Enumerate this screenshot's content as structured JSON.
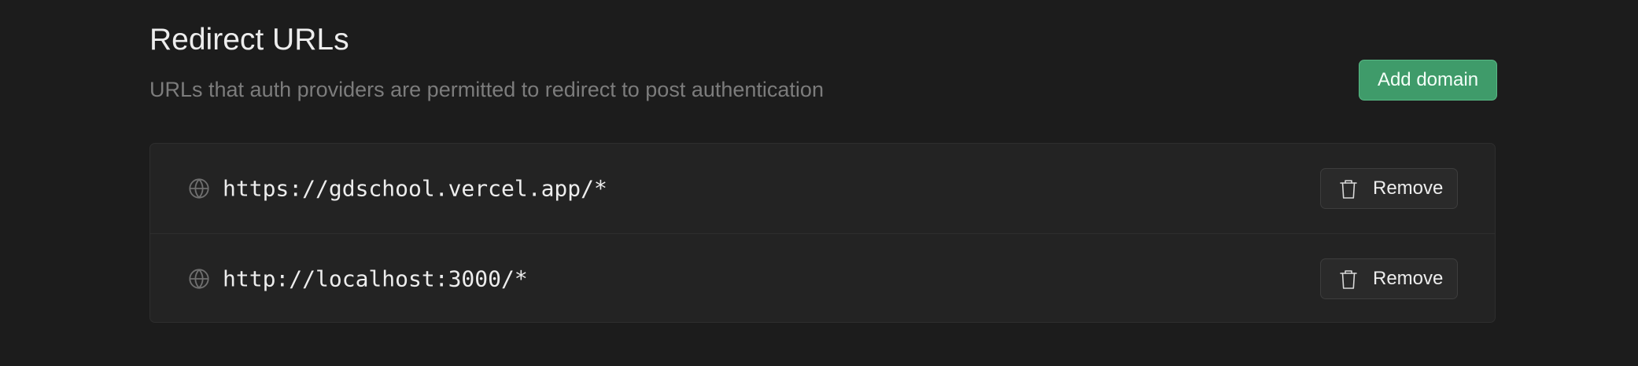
{
  "section": {
    "title": "Redirect URLs",
    "description": "URLs that auth providers are permitted to redirect to post authentication",
    "add_button_label": "Add domain"
  },
  "redirect_urls": [
    {
      "url": "https://gdschool.vercel.app/*",
      "remove_label": "Remove",
      "icon": "globe-icon"
    },
    {
      "url": "http://localhost:3000/*",
      "remove_label": "Remove",
      "icon": "globe-icon"
    }
  ],
  "colors": {
    "background": "#1c1c1c",
    "panel": "#232323",
    "accent_green": "#3f9b6a",
    "muted_text": "#7c7c7c"
  }
}
